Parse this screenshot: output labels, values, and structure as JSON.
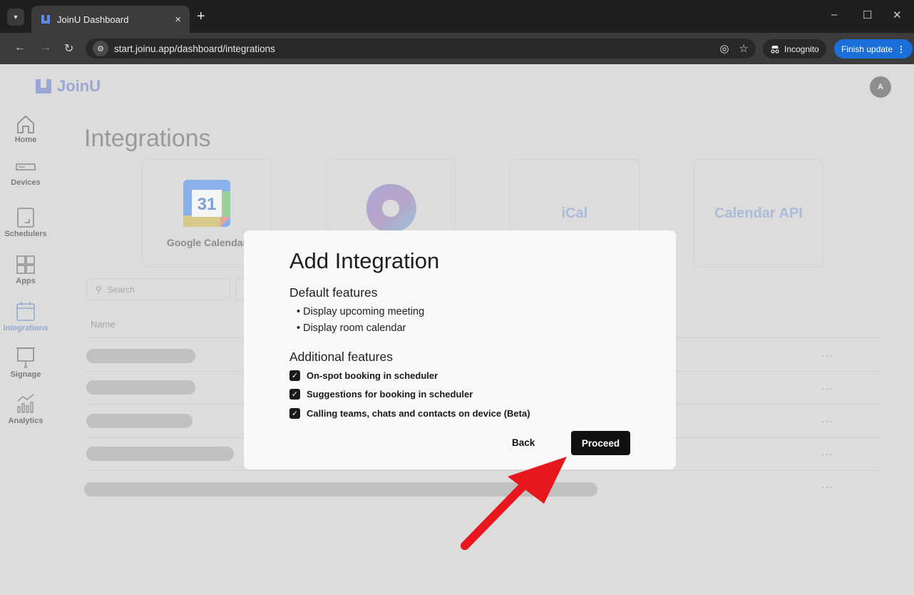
{
  "browser": {
    "tab_title": "JoinU Dashboard",
    "tab_close": "×",
    "new_tab": "+",
    "url": "start.joinu.app/dashboard/integrations",
    "incognito_label": "Incognito",
    "finish_update_label": "Finish update",
    "window_controls": [
      "–",
      "☐",
      "✕"
    ]
  },
  "app": {
    "logo_text": "JoinU",
    "avatar_initial": "A",
    "sidebar": [
      {
        "label": "Home",
        "icon": "home-icon"
      },
      {
        "label": "Devices",
        "icon": "devices-icon"
      },
      {
        "label": "Schedulers",
        "icon": "schedulers-icon"
      },
      {
        "label": "Apps",
        "icon": "apps-icon"
      },
      {
        "label": "Integrations",
        "icon": "calendar-icon",
        "active": true
      },
      {
        "label": "Signage",
        "icon": "signage-icon"
      },
      {
        "label": "Analytics",
        "icon": "analytics-icon"
      }
    ],
    "page_title": "Integrations",
    "integrations": [
      {
        "label": "Google Calendar",
        "icon": "google-calendar-icon",
        "icon_text": "31"
      },
      {
        "label": "",
        "icon": "microsoft-365-icon"
      },
      {
        "label": "iCal",
        "icon": null
      },
      {
        "label": "Calendar API",
        "icon": null
      }
    ],
    "search_placeholder": "Search",
    "table": {
      "name_header": "Name",
      "row_menu": "···"
    }
  },
  "modal": {
    "title": "Add Integration",
    "default_heading": "Default features",
    "default_features": [
      "Display upcoming meeting",
      "Display room calendar"
    ],
    "additional_heading": "Additional features",
    "additional_features": [
      {
        "label": "On-spot booking in scheduler",
        "checked": true
      },
      {
        "label": "Suggestions for booking in scheduler",
        "checked": true
      },
      {
        "label": "Calling teams, chats and contacts on device (Beta)",
        "checked": true
      }
    ],
    "back_label": "Back",
    "proceed_label": "Proceed"
  },
  "colors": {
    "accent_blue": "#1b6fd8",
    "annotation_arrow": "#e8161d",
    "primary_button": "#111111"
  }
}
